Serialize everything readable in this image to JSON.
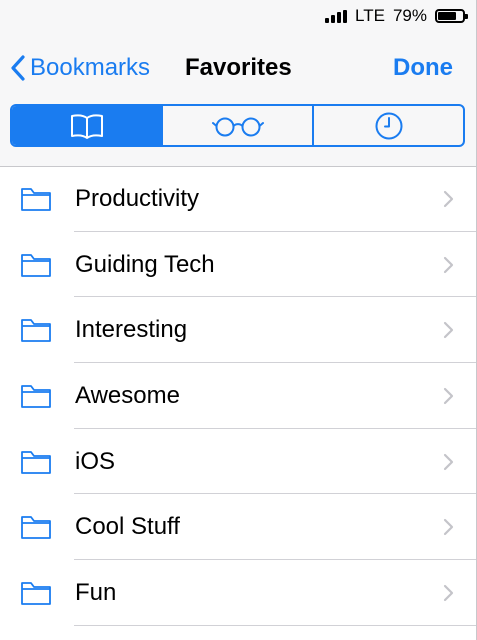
{
  "status_bar": {
    "network": "LTE",
    "battery_percent_text": "79%",
    "battery_level": 0.79
  },
  "nav": {
    "back_label": "Bookmarks",
    "title": "Favorites",
    "done_label": "Done"
  },
  "segments": [
    {
      "icon": "book-icon",
      "selected": true
    },
    {
      "icon": "reading-glasses-icon",
      "selected": false
    },
    {
      "icon": "clock-icon",
      "selected": false
    }
  ],
  "folders": [
    {
      "label": "Productivity"
    },
    {
      "label": "Guiding Tech"
    },
    {
      "label": "Interesting"
    },
    {
      "label": "Awesome"
    },
    {
      "label": "iOS"
    },
    {
      "label": "Cool Stuff"
    },
    {
      "label": "Fun"
    }
  ],
  "colors": {
    "accent": "#1a7cf0",
    "separator": "#d1d1d6",
    "chevron": "#c4c4c9",
    "header_bg": "#f7f7f8"
  }
}
